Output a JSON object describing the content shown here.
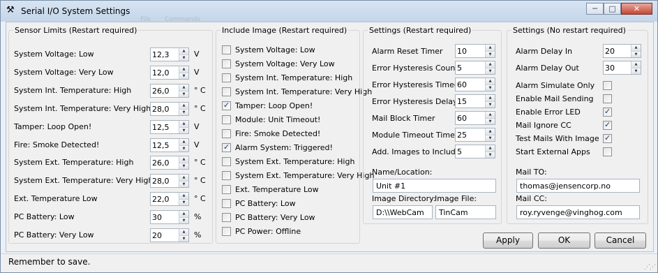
{
  "window": {
    "title": "Serial I/O System Settings",
    "title_icon": "tools-icon",
    "background_menu": [
      "File",
      "Commands"
    ],
    "caption_buttons": {
      "minimize": "─",
      "maximize": "□",
      "close": "✕"
    }
  },
  "sensor_limits": {
    "title": "Sensor Limits (Restart required)",
    "rows": [
      {
        "label": "System Voltage: Low",
        "value": "12,3",
        "unit": "V"
      },
      {
        "label": "System Voltage: Very Low",
        "value": "12,0",
        "unit": "V"
      },
      {
        "label": "System Int. Temperature: High",
        "value": "26,0",
        "unit": "° C"
      },
      {
        "label": "System Int. Temperature: Very High",
        "value": "28,0",
        "unit": "° C"
      },
      {
        "label": "Tamper: Loop Open!",
        "value": "12,5",
        "unit": "V"
      },
      {
        "label": "Fire: Smoke Detected!",
        "value": "12,5",
        "unit": "V"
      },
      {
        "label": "System Ext. Temperature: High",
        "value": "26,0",
        "unit": "° C"
      },
      {
        "label": "System Ext. Temperature: Very High",
        "value": "28,0",
        "unit": "° C"
      },
      {
        "label": "Ext. Temperature Low",
        "value": "22,0",
        "unit": "° C"
      },
      {
        "label": "PC Battery: Low",
        "value": "30",
        "unit": "%"
      },
      {
        "label": "PC Battery: Very Low",
        "value": "20",
        "unit": "%"
      }
    ]
  },
  "include_image": {
    "title": "Include Image (Restart required)",
    "items": [
      {
        "label": "System Voltage: Low",
        "checked": false
      },
      {
        "label": "System Voltage: Very Low",
        "checked": false
      },
      {
        "label": "System Int. Temperature: High",
        "checked": false
      },
      {
        "label": "System Int. Temperature: Very High",
        "checked": false
      },
      {
        "label": "Tamper: Loop Open!",
        "checked": true
      },
      {
        "label": "Module: Unit Timeout!",
        "checked": false
      },
      {
        "label": "Fire: Smoke Detected!",
        "checked": false
      },
      {
        "label": "Alarm System: Triggered!",
        "checked": true
      },
      {
        "label": "System Ext. Temperature: High",
        "checked": false
      },
      {
        "label": "System Ext. Temperature: Very High",
        "checked": false
      },
      {
        "label": "Ext. Temperature Low",
        "checked": false
      },
      {
        "label": "PC Battery: Low",
        "checked": false
      },
      {
        "label": "PC Battery: Very Low",
        "checked": false
      },
      {
        "label": "PC Power: Offline",
        "checked": false
      }
    ]
  },
  "settings_restart": {
    "title": "Settings (Restart required)",
    "rows": [
      {
        "label": "Alarm Reset Timer",
        "value": "10"
      },
      {
        "label": "Error Hysteresis Counter",
        "value": "5"
      },
      {
        "label": "Error Hysteresis Timeout",
        "value": "60"
      },
      {
        "label": "Error Hysteresis Delay",
        "value": "15"
      },
      {
        "label": "Mail Block Timer",
        "value": "60"
      },
      {
        "label": "Module Timeout Timer",
        "value": "25"
      },
      {
        "label": "Add. Images to Include",
        "value": "5"
      }
    ],
    "name_location_label": "Name/Location:",
    "name_location_value": "Unit #1",
    "image_directory_label": "Image Directory:",
    "image_directory_value": "D:\\\\WebCam",
    "image_file_label": "Image File:",
    "image_file_value": "TinCam"
  },
  "settings_no_restart": {
    "title": "Settings (No restart required)",
    "spin_rows": [
      {
        "label": "Alarm Delay In",
        "value": "20"
      },
      {
        "label": "Alarm Delay Out",
        "value": "30"
      }
    ],
    "check_rows": [
      {
        "label": "Alarm Simulate Only",
        "checked": false
      },
      {
        "label": "Enable Mail Sending",
        "checked": false
      },
      {
        "label": "Enable Error LED",
        "checked": true
      },
      {
        "label": "Mail Ignore CC",
        "checked": true
      },
      {
        "label": "Test Mails With Image",
        "checked": true
      },
      {
        "label": "Start External Apps",
        "checked": false
      }
    ],
    "mail_to_label": "Mail TO:",
    "mail_to_value": "thomas@jensencorp.no",
    "mail_cc_label": "Mail CC:",
    "mail_cc_value": "roy.ryvenge@vinghog.com"
  },
  "buttons": {
    "apply": "Apply",
    "ok": "OK",
    "cancel": "Cancel"
  },
  "status": {
    "text": "Remember to save."
  }
}
